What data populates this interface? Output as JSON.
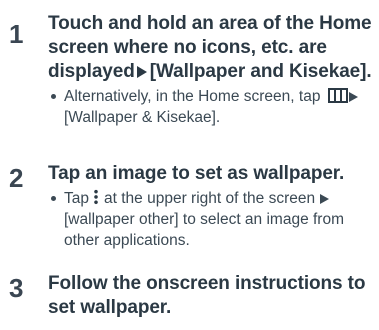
{
  "steps": [
    {
      "number": "1",
      "title_part1": "Touch and hold an area of the Home screen where no icons, etc. are displayed",
      "title_part2": "[Wallpaper and Kisekae].",
      "bullet_part1": "Alternatively, in the Home screen, tap",
      "bullet_part2": "[Wallpaper & Kisekae]."
    },
    {
      "number": "2",
      "title": "Tap an image to set as wallpaper.",
      "bullet_part1": "Tap",
      "bullet_part2": "at the upper right of the screen",
      "bullet_part3": "[wallpaper other] to select an image from other applications."
    },
    {
      "number": "3",
      "title": "Follow the onscreen instructions to set wallpaper."
    }
  ],
  "icons": {
    "arrow": "triangle-right-icon",
    "apps": "apps-grid-icon",
    "menu": "vertical-dots-menu-icon"
  }
}
